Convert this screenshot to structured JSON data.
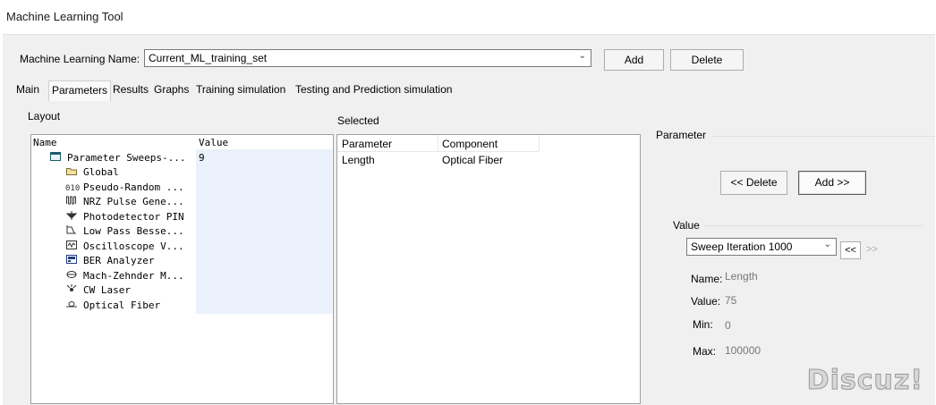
{
  "window": {
    "title": "Machine Learning Tool"
  },
  "header": {
    "name_label": "Machine Learning Name:",
    "name_value": "Current_ML_training_set",
    "add_label": "Add",
    "delete_label": "Delete"
  },
  "tabs": [
    {
      "label": "Main"
    },
    {
      "label": "Parameters"
    },
    {
      "label": "Results"
    },
    {
      "label": "Graphs"
    },
    {
      "label": "Training simulation"
    },
    {
      "label": "Testing and Prediction simulation"
    }
  ],
  "layout_panel": {
    "title": "Layout",
    "col_name": "Name",
    "col_value": "Value",
    "items": [
      {
        "label": "Parameter Sweeps-...",
        "value": "9",
        "icon": "sweep-icon"
      },
      {
        "label": "Global",
        "value": "",
        "icon": "folder-icon"
      },
      {
        "label": "Pseudo-Random ...",
        "value": "",
        "icon": "prbs-icon"
      },
      {
        "label": "NRZ Pulse Gene...",
        "value": "",
        "icon": "nrz-pulse-icon"
      },
      {
        "label": "Photodetector PIN",
        "value": "",
        "icon": "photodetector-icon"
      },
      {
        "label": "Low Pass Besse...",
        "value": "",
        "icon": "lowpass-filter-icon"
      },
      {
        "label": "Oscilloscope V...",
        "value": "",
        "icon": "oscilloscope-icon"
      },
      {
        "label": "BER Analyzer",
        "value": "",
        "icon": "ber-analyzer-icon"
      },
      {
        "label": "Mach-Zehnder M...",
        "value": "",
        "icon": "mach-zehnder-icon"
      },
      {
        "label": "CW Laser",
        "value": "",
        "icon": "cw-laser-icon"
      },
      {
        "label": "Optical Fiber",
        "value": "",
        "icon": "optical-fiber-icon"
      }
    ]
  },
  "selected_panel": {
    "title": "Selected",
    "col_parameter": "Parameter",
    "col_component": "Component",
    "rows": [
      {
        "parameter": "Length",
        "component": "Optical Fiber"
      }
    ]
  },
  "parameter_panel": {
    "title": "Parameter",
    "delete_label": "<< Delete",
    "add_label": "Add >>",
    "value_group": {
      "title": "Value",
      "sweep_select": "Sweep Iteration 1000",
      "prev_label": "<<",
      "next_label": ">>",
      "name_label": "Name:",
      "name_value": "Length",
      "value_label": "Value:",
      "value_value": "75",
      "min_label": "Min:",
      "min_value": "0",
      "max_label": "Max:",
      "max_value": "100000"
    }
  },
  "watermark": "Discuz!"
}
